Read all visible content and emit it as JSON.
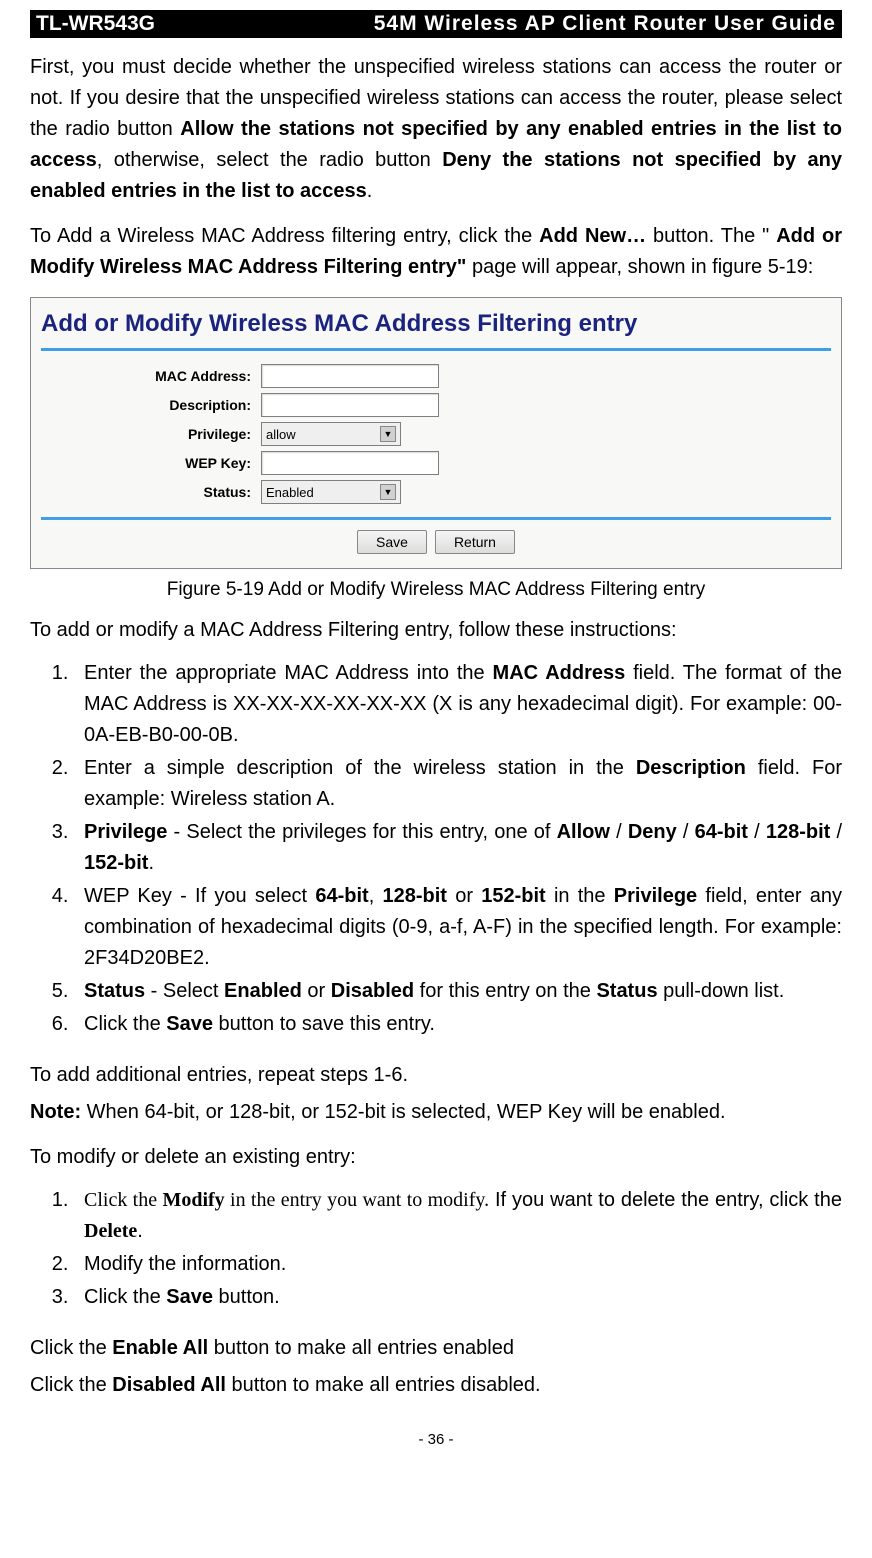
{
  "header": {
    "model": "TL-WR543G",
    "title": "54M Wireless AP Client Router User Guide"
  },
  "para1": {
    "t1": "First, you must decide whether the unspecified wireless stations can access the router or not. If you desire that the unspecified wireless stations can access the router, please select the radio button ",
    "b1": "Allow the stations not specified by any enabled entries in the list to access",
    "t2": ", otherwise, select the radio button ",
    "b2": "Deny the stations not specified by any enabled entries in the list to access",
    "t3": "."
  },
  "para2": {
    "t1": "To Add a Wireless MAC Address filtering entry, click the ",
    "b1": "Add New…",
    "t2": " button. The \" ",
    "b2": "Add or Modify Wireless MAC Address Filtering entry\"",
    "t3": " page will appear, shown in figure 5-19:"
  },
  "figure": {
    "title": "Add or Modify Wireless MAC Address Filtering entry",
    "fields": {
      "mac_label": "MAC Address:",
      "desc_label": "Description:",
      "priv_label": "Privilege:",
      "priv_value": "allow",
      "wep_label": "WEP Key:",
      "status_label": "Status:",
      "status_value": "Enabled"
    },
    "buttons": {
      "save": "Save",
      "return": "Return"
    }
  },
  "caption": "Figure 5-19    Add or Modify Wireless MAC Address Filtering entry",
  "para3": "To add or modify a MAC Address Filtering entry, follow these instructions:",
  "list1": {
    "i1": {
      "t1": "Enter the appropriate MAC Address into the ",
      "b1": "MAC Address",
      "t2": " field. The format of the MAC Address is XX-XX-XX-XX-XX-XX (X is any hexadecimal digit). For example: 00-0A-EB-B0-00-0B."
    },
    "i2": {
      "t1": "Enter a simple description of the wireless station in the ",
      "b1": "Description",
      "t2": " field. For example: Wireless station A."
    },
    "i3": {
      "b1": "Privilege",
      "t1": " - Select the privileges for this entry, one of ",
      "b2": "Allow",
      "t2": " / ",
      "b3": "Deny",
      "t3": " / ",
      "b4": "64-bit",
      "t4": " / ",
      "b5": "128-bit",
      "t5": " / ",
      "b6": "152-bit",
      "t6": "."
    },
    "i4": {
      "t1": "WEP Key - If you select ",
      "b1": "64-bit",
      "t2": ", ",
      "b2": "128-bit",
      "t3": " or ",
      "b3": "152-bit",
      "t4": " in the ",
      "b4": "Privilege",
      "t5": " field, enter any combination of hexadecimal digits (0-9, a-f, A-F) in the specified length. For example: 2F34D20BE2."
    },
    "i5": {
      "b1": "Status",
      "t1": " - Select ",
      "b2": "Enabled",
      "t2": " or ",
      "b3": "Disabled",
      "t3": " for this entry on the ",
      "b4": "Status",
      "t4": " pull-down list."
    },
    "i6": {
      "t1": "Click the ",
      "b1": "Save",
      "t2": " button to save this entry."
    }
  },
  "para4": "To add additional entries, repeat steps 1-6.",
  "para5": {
    "b1": "Note:",
    "t1": " When 64-bit, or 128-bit, or 152-bit is selected, WEP Key will be enabled."
  },
  "para6": "To modify or delete an existing entry:",
  "list2": {
    "i1": {
      "s1": "Click the ",
      "sb1": "Modify",
      "s2": " in the entry you want to modify.",
      "t1": " If you want to delete the entry, click the ",
      "sb2": "Delete",
      "t2": "."
    },
    "i2": "Modify the information.",
    "i3": {
      "t1": "Click the ",
      "b1": "Save",
      "t2": " button."
    }
  },
  "para7": {
    "t1": "Click the ",
    "b1": "Enable All",
    "t2": " button to make all entries enabled"
  },
  "para8": {
    "t1": "Click the ",
    "b1": "Disabled All",
    "t2": " button to make all entries disabled."
  },
  "footer": "- 36 -"
}
